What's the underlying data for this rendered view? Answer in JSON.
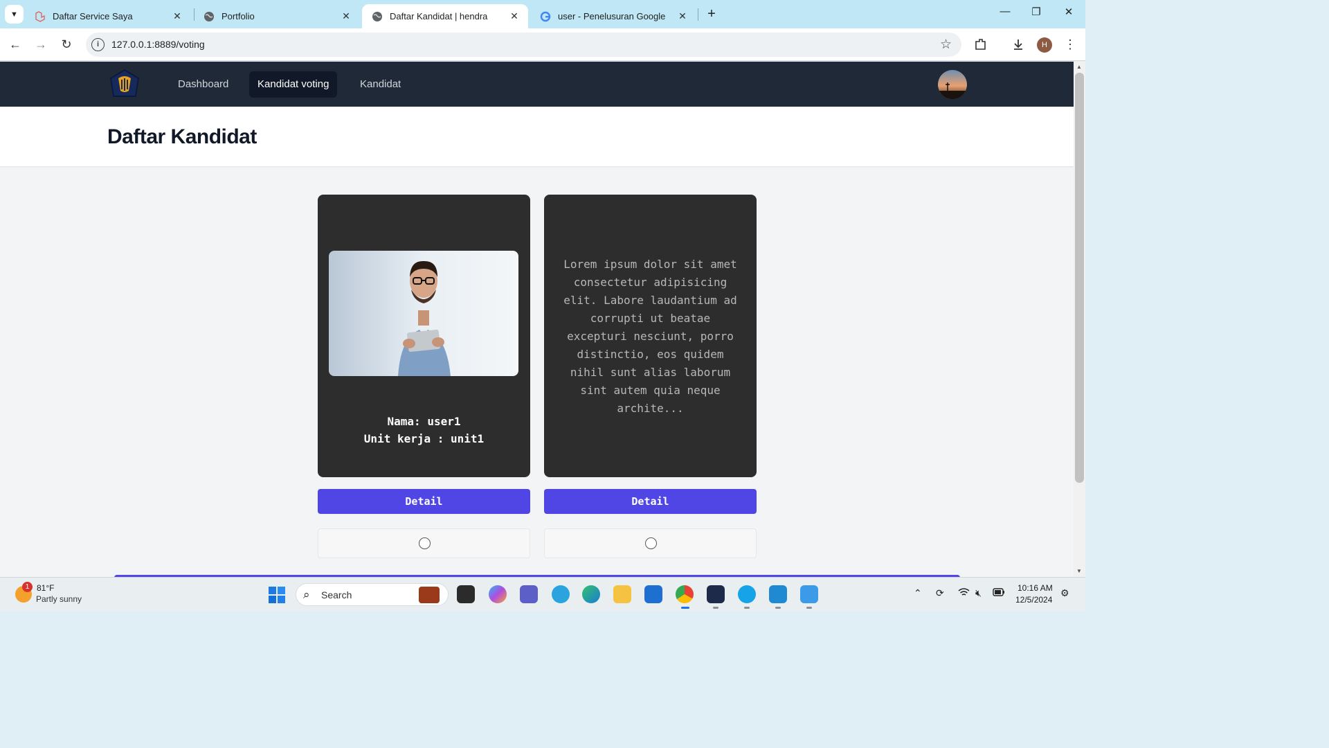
{
  "browser": {
    "tabs": [
      {
        "title": "Daftar Service Saya",
        "close": "✕",
        "favicon": "laravel-icon"
      },
      {
        "title": "Portfolio",
        "close": "✕",
        "favicon": "globe-icon"
      },
      {
        "title": "Daftar Kandidat | hendra",
        "close": "✕",
        "favicon": "globe-icon",
        "active": true
      },
      {
        "title": "user - Penelusuran Google",
        "close": "✕",
        "favicon": "google-icon"
      }
    ],
    "new_tab": "+",
    "url": "127.0.0.1:8889/voting",
    "profile_initial": "H"
  },
  "navbar": {
    "links": [
      "Dashboard",
      "Kandidat voting",
      "Kandidat"
    ],
    "active_link": "Kandidat voting"
  },
  "page": {
    "title": "Daftar Kandidat"
  },
  "cards": [
    {
      "type": "profile",
      "name_line": "Nama: user1",
      "unit_line": "Unit kerja : unit1",
      "button": "Detail"
    },
    {
      "type": "description",
      "description": "Lorem ipsum dolor sit amet consectetur adipisicing elit. Labore laudantium ad corrupti ut beatae excepturi nesciunt, porro distinctio, eos quidem nihil sunt alias laborum sint autem quia neque archite...",
      "button": "Detail"
    }
  ],
  "taskbar": {
    "weather": {
      "badge": "1",
      "temp": "81°F",
      "condition": "Partly sunny"
    },
    "search_placeholder": "Search",
    "clock": {
      "time": "10:16 AM",
      "date": "12/5/2024"
    }
  },
  "colors": {
    "navbar": "#1f2937",
    "card": "#2d2d2d",
    "button": "#4f46e5",
    "tabstrip": "#bfe7f5"
  }
}
